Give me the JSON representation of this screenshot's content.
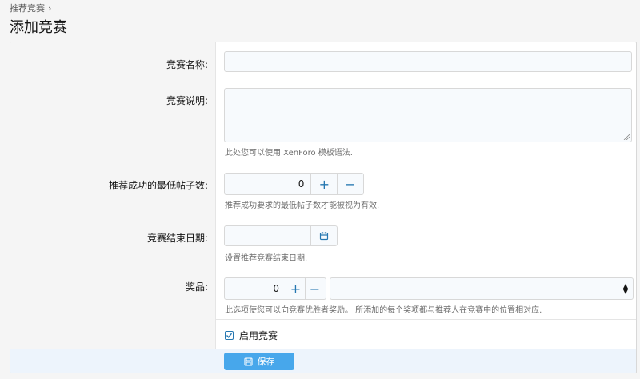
{
  "breadcrumb": {
    "item": "推荐竞赛",
    "separator": "›"
  },
  "page": {
    "title": "添加竞赛"
  },
  "form": {
    "name": {
      "label": "竞赛名称:",
      "value": ""
    },
    "description": {
      "label": "竞赛说明:",
      "value": "",
      "hint": "此处您可以使用 XenForo 模板语法."
    },
    "min_posts": {
      "label": "推荐成功的最低帖子数:",
      "value": "0",
      "hint": "推荐成功要求的最低帖子数才能被视为有效."
    },
    "end_date": {
      "label": "竞赛结束日期:",
      "value": "",
      "hint": "设置推荐竞赛结束日期."
    },
    "prizes": {
      "label": "奖品:",
      "value": "0",
      "selected": "",
      "hint": "此选项使您可以向竞赛优胜者奖励。 所添加的每个奖项都与推荐人在竞赛中的位置相对应."
    },
    "enable": {
      "label": "启用竞赛",
      "checked": true
    },
    "save": {
      "label": "保存"
    }
  },
  "icons": {
    "plus": "+",
    "minus": "−",
    "calendar": "calendar-icon",
    "save": "save-icon"
  },
  "colors": {
    "accent": "#2577b1",
    "button": "#47a7eb",
    "footer": "#edf4fc"
  }
}
